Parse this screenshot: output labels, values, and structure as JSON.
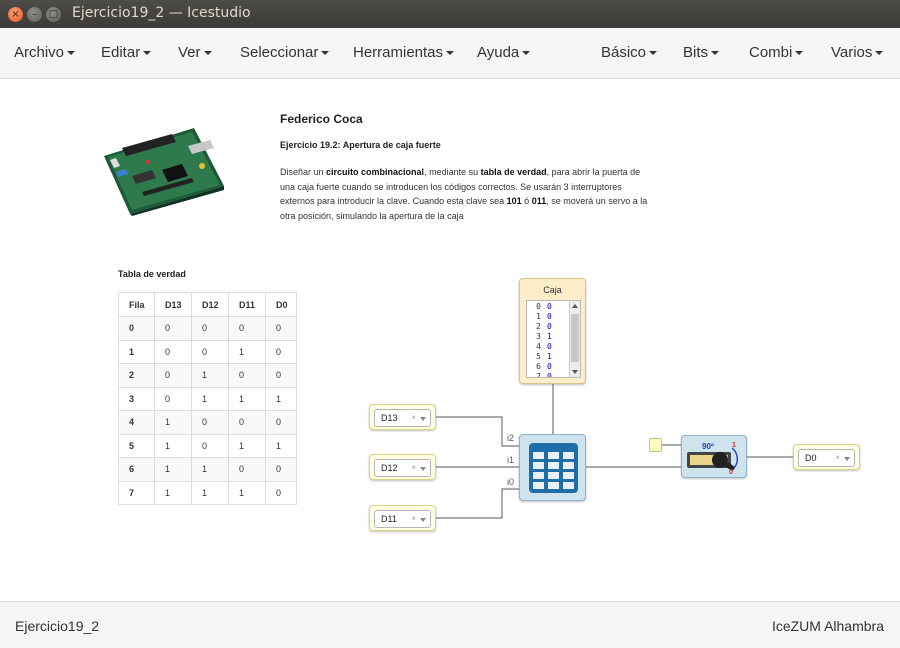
{
  "window": {
    "title": "Ejercicio19_2 — Icestudio",
    "close_glyph": "×",
    "min_glyph": "–",
    "max_glyph": "□"
  },
  "menubar": {
    "left": [
      "Archivo",
      "Editar",
      "Ver",
      "Seleccionar",
      "Herramientas",
      "Ayuda"
    ],
    "right": [
      "Básico",
      "Bits",
      "Combi",
      "Varios"
    ]
  },
  "info": {
    "author": "Federico Coca",
    "exercise_number": "Ejercicio 19.2:",
    "exercise_title": "Apertura de caja fuerte",
    "desc_1": "Diseñar un ",
    "desc_bold_1": "circuito combinacional",
    "desc_2": ", mediante su ",
    "desc_bold_2": "tabla de verdad",
    "desc_3": ", para abrir la puerta de una caja fuerte cuando se introducen los códigos correctos. Se usarán 3 interruptores externos para introducir la clave. Cuando esta clave sea ",
    "desc_bold_3": "101",
    "desc_4": " ó ",
    "desc_bold_4": "011",
    "desc_5": ", se moverá un servo a la otra posición, simulando la apertura de la caja"
  },
  "truth_table": {
    "caption": "Tabla de verdad",
    "headers": [
      "Fila",
      "D13",
      "D12",
      "D11",
      "D0"
    ],
    "rows": [
      [
        "0",
        "0",
        "0",
        "0",
        "0"
      ],
      [
        "1",
        "0",
        "0",
        "1",
        "0"
      ],
      [
        "2",
        "0",
        "1",
        "0",
        "0"
      ],
      [
        "3",
        "0",
        "1",
        "1",
        "1"
      ],
      [
        "4",
        "1",
        "0",
        "0",
        "0"
      ],
      [
        "5",
        "1",
        "0",
        "1",
        "1"
      ],
      [
        "6",
        "1",
        "1",
        "0",
        "0"
      ],
      [
        "7",
        "1",
        "1",
        "1",
        "0"
      ]
    ]
  },
  "circuit": {
    "inputs": [
      {
        "pin": "D13",
        "clear": "×",
        "port": "i2"
      },
      {
        "pin": "D12",
        "clear": "×",
        "port": "i1"
      },
      {
        "pin": "D11",
        "clear": "×",
        "port": "i0"
      }
    ],
    "output": {
      "pin": "D0",
      "clear": "×"
    },
    "memory": {
      "title": "Caja",
      "rows": [
        {
          "n": "0",
          "v": "0"
        },
        {
          "n": "1",
          "v": "0"
        },
        {
          "n": "2",
          "v": "0"
        },
        {
          "n": "3",
          "v": "1"
        },
        {
          "n": "4",
          "v": "0"
        },
        {
          "n": "5",
          "v": "1"
        },
        {
          "n": "6",
          "v": "0"
        },
        {
          "n": "7",
          "v": "0"
        }
      ]
    },
    "servo": {
      "angle_label": "90º",
      "label_1": "1",
      "label_0": "0"
    }
  },
  "statusbar": {
    "left": "Ejercicio19_2",
    "right": "IceZUM Alhambra"
  },
  "colors": {
    "titlebar": "#3c3b37",
    "close_button": "#e9541f",
    "block_yellow": "#fffee0",
    "block_blue": "#cfe3ef",
    "memory_orange": "#fceec8"
  }
}
